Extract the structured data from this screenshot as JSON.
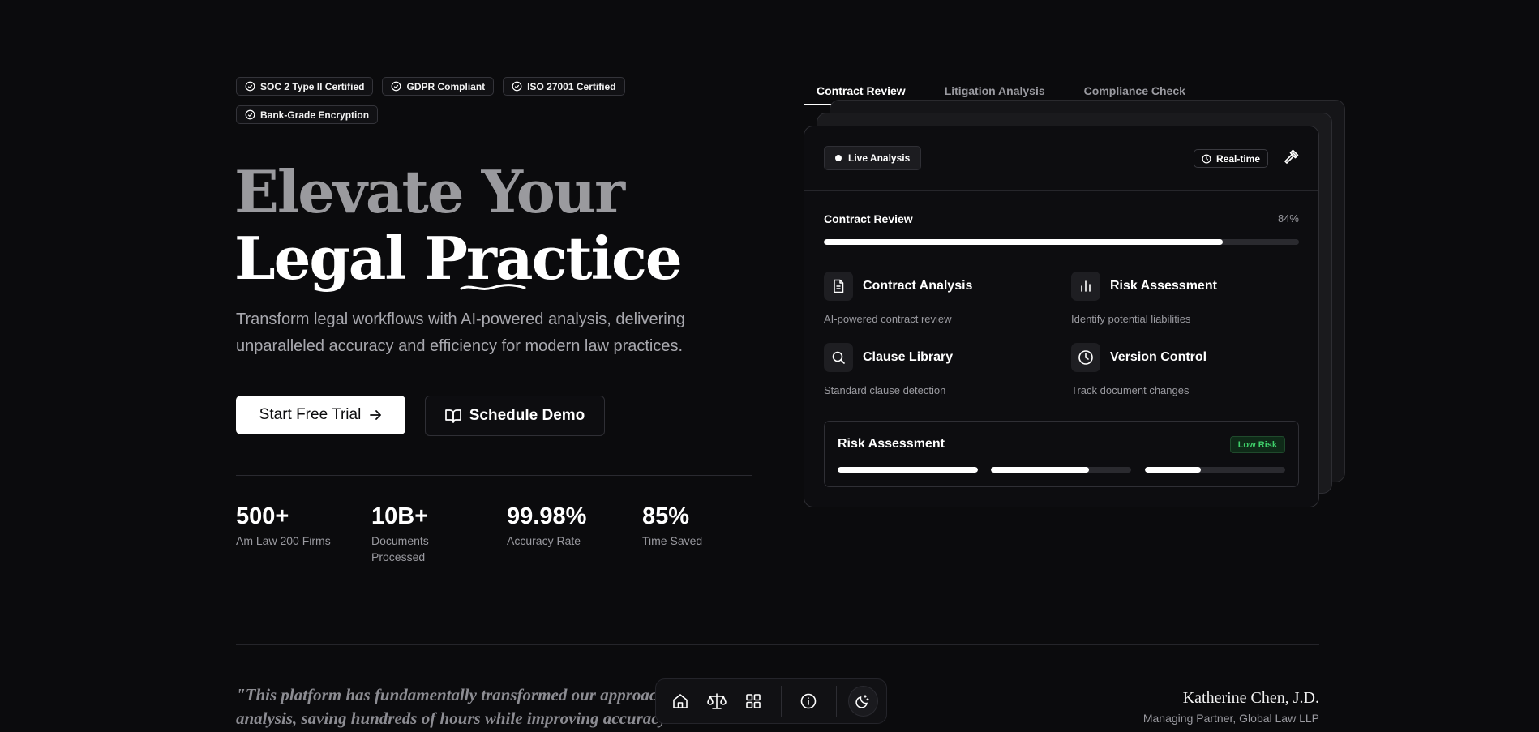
{
  "certifications": [
    "SOC 2 Type II Certified",
    "GDPR Compliant",
    "ISO 27001 Certified",
    "Bank-Grade Encryption"
  ],
  "hero": {
    "headline_line1": "Elevate Your",
    "headline_line2": "Legal Practice",
    "subtitle": "Transform legal workflows with AI-powered analysis, delivering unparalleled accuracy and efficiency for modern law practices.",
    "primary_cta": "Start Free Trial",
    "secondary_cta": "Schedule Demo"
  },
  "stats": [
    {
      "value": "500+",
      "label": "Am Law 200 Firms"
    },
    {
      "value": "10B+",
      "label": "Documents Processed"
    },
    {
      "value": "99.98%",
      "label": "Accuracy Rate"
    },
    {
      "value": "85%",
      "label": "Time Saved"
    }
  ],
  "tabs": [
    "Contract Review",
    "Litigation Analysis",
    "Compliance Check"
  ],
  "panel": {
    "live_label": "Live Analysis",
    "realtime_label": "Real-time",
    "progress_title": "Contract Review",
    "progress_value": 84,
    "progress_text": "84%",
    "features": [
      {
        "icon": "document-icon",
        "title": "Contract Analysis",
        "desc": "AI-powered contract review"
      },
      {
        "icon": "bar-chart-icon",
        "title": "Risk Assessment",
        "desc": "Identify potential liabilities"
      },
      {
        "icon": "search-icon",
        "title": "Clause Library",
        "desc": "Standard clause detection"
      },
      {
        "icon": "clock-icon",
        "title": "Version Control",
        "desc": "Track document changes"
      }
    ],
    "risk": {
      "title": "Risk Assessment",
      "badge": "Low Risk",
      "levels": [
        1.0,
        0.7,
        0.4
      ]
    }
  },
  "testimonial": {
    "quote": "\"This platform has fundamentally transformed our approach to contract analysis, saving hundreds of hours while improving accuracy.\"",
    "name": "Katherine Chen, J.D.",
    "role": "Managing Partner, Global Law LLP"
  },
  "dock": [
    "home-icon",
    "scale-icon",
    "grid-icon",
    "info-icon",
    "theme-toggle-icon"
  ]
}
